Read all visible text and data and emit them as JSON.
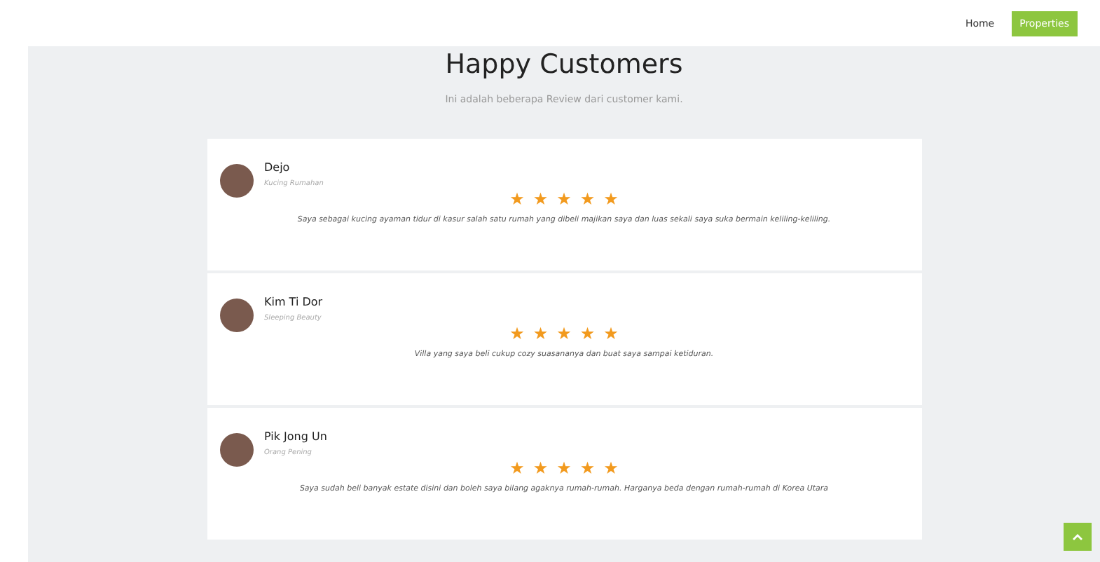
{
  "nav": [
    {
      "label": "Home",
      "selected": false
    },
    {
      "label": "Properties",
      "selected": true
    }
  ],
  "header": {
    "title": "Happy Customers",
    "subtitle": "Ini adalah beberapa Review dari customer kami."
  },
  "reviews": [
    {
      "name": "Dejo",
      "role": "Kucing Rumahan",
      "stars": 5,
      "text": "Saya sebagai kucing ayaman tidur di kasur salah satu rumah yang dibeli majikan saya dan luas sekali saya suka bermain keliling-keliling."
    },
    {
      "name": "Kim Ti Dor",
      "role": "Sleeping Beauty",
      "stars": 5,
      "text": "Villa yang saya beli cukup cozy suasananya dan buat saya sampai ketiduran."
    },
    {
      "name": "Pik Jong Un",
      "role": "Orang Pening",
      "stars": 5,
      "text": "Saya sudah beli banyak estate disini dan boleh saya bilang agaknya rumah-rumah. Harganya beda dengan rumah-rumah di Korea Utara"
    }
  ]
}
